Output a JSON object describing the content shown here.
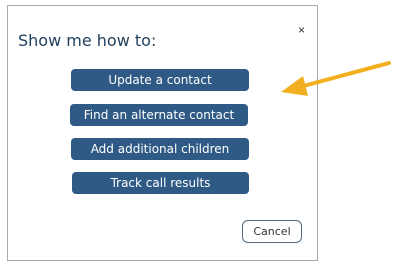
{
  "dialog": {
    "title": "Show me how to:",
    "close_glyph": "×",
    "actions": [
      {
        "label": "Update a contact"
      },
      {
        "label": "Find an alternate contact"
      },
      {
        "label": "Add additional children"
      },
      {
        "label": "Track call results"
      }
    ],
    "cancel_label": "Cancel"
  },
  "annotation": {
    "arrow_color": "#f2b021",
    "arrow_icon": "arrow-left-icon"
  },
  "colors": {
    "button_bg": "#2f5a86",
    "title_text": "#22415f",
    "dialog_border": "#a9a9a9"
  }
}
